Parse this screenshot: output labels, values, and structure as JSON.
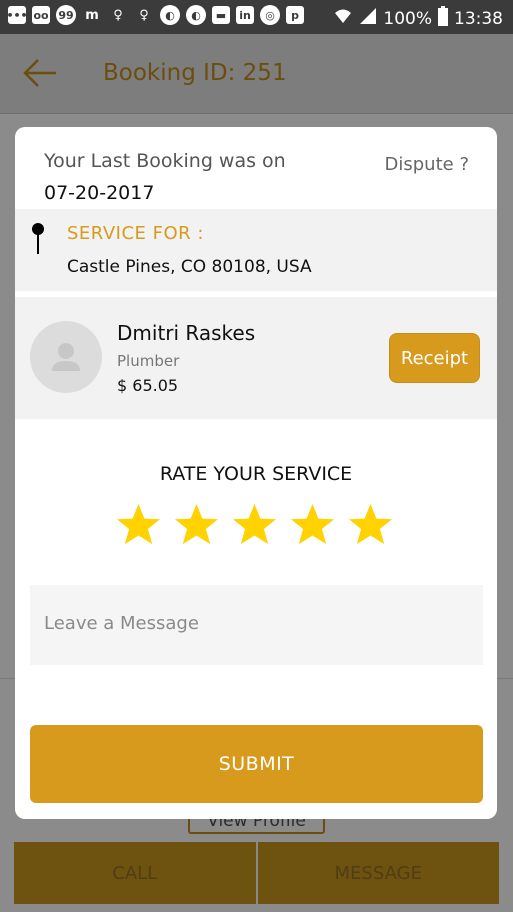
{
  "status_bar": {
    "battery_text": "100%",
    "time": "13:38",
    "notification_icons": [
      "more-icon",
      "voicemail-icon",
      "chat-bubble-icon",
      "m-app-icon",
      "bulb-icon",
      "bulb-icon",
      "headset-icon",
      "headset-icon",
      "message-icon",
      "linkedin-icon",
      "target-icon",
      "p-app-icon"
    ]
  },
  "appbar": {
    "title": "Booking ID: 251"
  },
  "background": {
    "view_profile": "View Profile",
    "call": "CALL",
    "message": "MESSAGE"
  },
  "dialog": {
    "last_booking_label": "Your Last Booking was on",
    "last_booking_date": "07-20-2017",
    "dispute": "Dispute ?",
    "service_for_label": "SERVICE FOR :",
    "service_address": "Castle Pines, CO 80108, USA",
    "provider": {
      "name": "Dmitri Raskes",
      "role": "Plumber",
      "price": "$ 65.05"
    },
    "receipt": "Receipt",
    "rate_title": "RATE YOUR SERVICE",
    "rating": 5,
    "rating_max": 5,
    "message_placeholder": "Leave a Message",
    "submit": "SUBMIT"
  },
  "colors": {
    "accent": "#D89A1C",
    "star": "#FFD200",
    "status_bar": "#3B3B3B"
  }
}
